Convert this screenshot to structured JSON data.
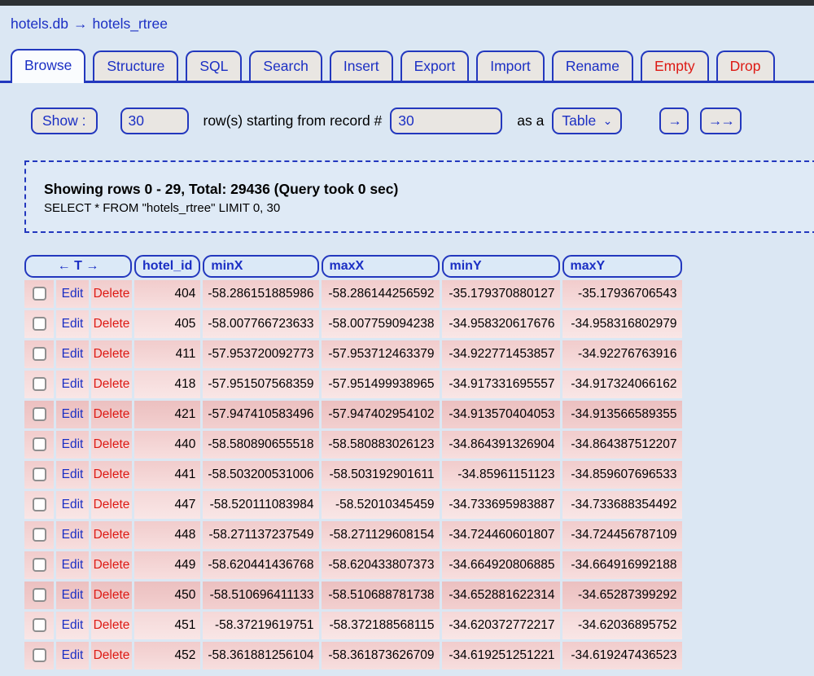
{
  "breadcrumb": {
    "db": "hotels.db",
    "separator": "→",
    "table": "hotels_rtree"
  },
  "tabs": [
    {
      "label": "Browse",
      "active": true,
      "danger": false
    },
    {
      "label": "Structure",
      "active": false,
      "danger": false
    },
    {
      "label": "SQL",
      "active": false,
      "danger": false
    },
    {
      "label": "Search",
      "active": false,
      "danger": false
    },
    {
      "label": "Insert",
      "active": false,
      "danger": false
    },
    {
      "label": "Export",
      "active": false,
      "danger": false
    },
    {
      "label": "Import",
      "active": false,
      "danger": false
    },
    {
      "label": "Rename",
      "active": false,
      "danger": false
    },
    {
      "label": "Empty",
      "active": false,
      "danger": true
    },
    {
      "label": "Drop",
      "active": false,
      "danger": true
    }
  ],
  "controls": {
    "show_label": "Show :",
    "rows_value": "30",
    "rows_text": "row(s) starting from record #",
    "start_value": "30",
    "as_a_text": "as a",
    "view_value": "Table",
    "chevron_icon": "⌄",
    "next_label": "→",
    "last_label": "→→"
  },
  "query_info": {
    "summary": "Showing rows 0 - 29, Total: 29436 (Query took 0 sec)",
    "sql": "SELECT * FROM \"hotels_rtree\" LIMIT 0, 30"
  },
  "table": {
    "nav_header": "← T →",
    "edit_label": "Edit",
    "delete_label": "Delete",
    "columns": [
      "hotel_id",
      "minX",
      "maxX",
      "minY",
      "maxY"
    ],
    "rows": [
      {
        "hotel_id": "404",
        "minX": "-58.286151885986",
        "maxX": "-58.286144256592",
        "minY": "-35.179370880127",
        "maxY": "-35.17936706543",
        "shade": "normal"
      },
      {
        "hotel_id": "405",
        "minX": "-58.007766723633",
        "maxX": "-58.007759094238",
        "minY": "-34.958320617676",
        "maxY": "-34.958316802979",
        "shade": "light"
      },
      {
        "hotel_id": "411",
        "minX": "-57.953720092773",
        "maxX": "-57.953712463379",
        "minY": "-34.922771453857",
        "maxY": "-34.92276763916",
        "shade": "normal"
      },
      {
        "hotel_id": "418",
        "minX": "-57.951507568359",
        "maxX": "-57.951499938965",
        "minY": "-34.917331695557",
        "maxY": "-34.917324066162",
        "shade": "light"
      },
      {
        "hotel_id": "421",
        "minX": "-57.947410583496",
        "maxX": "-57.947402954102",
        "minY": "-34.913570404053",
        "maxY": "-34.913566589355",
        "shade": "dark"
      },
      {
        "hotel_id": "440",
        "minX": "-58.580890655518",
        "maxX": "-58.580883026123",
        "minY": "-34.864391326904",
        "maxY": "-34.864387512207",
        "shade": "normal"
      },
      {
        "hotel_id": "441",
        "minX": "-58.503200531006",
        "maxX": "-58.503192901611",
        "minY": "-34.85961151123",
        "maxY": "-34.859607696533",
        "shade": "normal"
      },
      {
        "hotel_id": "447",
        "minX": "-58.520111083984",
        "maxX": "-58.52010345459",
        "minY": "-34.733695983887",
        "maxY": "-34.733688354492",
        "shade": "light"
      },
      {
        "hotel_id": "448",
        "minX": "-58.271137237549",
        "maxX": "-58.271129608154",
        "minY": "-34.724460601807",
        "maxY": "-34.724456787109",
        "shade": "normal"
      },
      {
        "hotel_id": "449",
        "minX": "-58.620441436768",
        "maxX": "-58.620433807373",
        "minY": "-34.664920806885",
        "maxY": "-34.664916992188",
        "shade": "normal"
      },
      {
        "hotel_id": "450",
        "minX": "-58.510696411133",
        "maxX": "-58.510688781738",
        "minY": "-34.652881622314",
        "maxY": "-34.65287399292",
        "shade": "dark"
      },
      {
        "hotel_id": "451",
        "minX": "-58.37219619751",
        "maxX": "-58.372188568115",
        "minY": "-34.620372772217",
        "maxY": "-34.62036895752",
        "shade": "light"
      },
      {
        "hotel_id": "452",
        "minX": "-58.361881256104",
        "maxX": "-58.361873626709",
        "minY": "-34.619251251221",
        "maxY": "-34.619247436523",
        "shade": "normal"
      }
    ]
  },
  "colors": {
    "accent_blue": "#2338be",
    "link_blue": "#1b2fc4",
    "danger_red": "#dd1a14",
    "page_bg": "#dbe7f3",
    "row_pink": "#f1cccc",
    "control_bg": "#e9e6e2"
  }
}
